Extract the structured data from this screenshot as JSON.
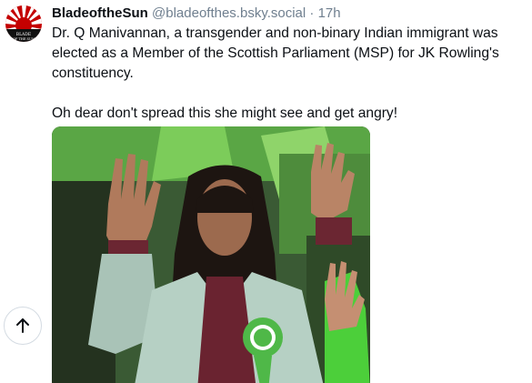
{
  "post": {
    "avatar": {
      "icon": "rising-sun-logo-icon",
      "logo_text": "BLADE OF THE SUN"
    },
    "author": {
      "display_name": "BladeoftheSun",
      "handle": "@bladeofthes.bsky.social",
      "separator": "·",
      "time": "17h"
    },
    "text": {
      "line1": "Dr. Q Manivannan, a transgender and non-binary Indian immigrant was elected as a Member of the Scottish Parliament (MSP) for JK Rowling's constituency.",
      "line2": "Oh dear don't spread this she might see and get angry!"
    },
    "image": {
      "icon": "photo-image"
    }
  },
  "controls": {
    "scroll_top_icon": "arrow-up-icon"
  },
  "colors": {
    "text": "#0b0f14",
    "muted": "#6f7f8f",
    "accent_green": "#3fb83a",
    "avatar_red": "#c40000"
  }
}
